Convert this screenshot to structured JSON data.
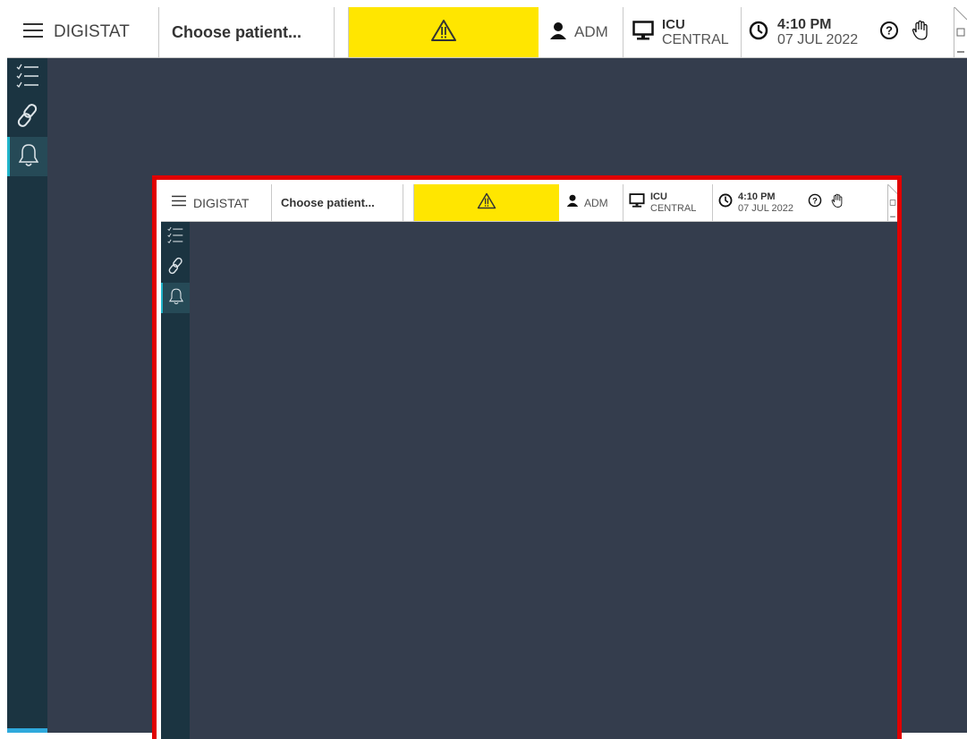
{
  "topbar": {
    "app_name": "DIGISTAT",
    "patient": "Choose patient...",
    "user": "ADM",
    "workstation": {
      "line1": "ICU",
      "line2": "CENTRAL"
    },
    "clock": {
      "time": "4:10 PM",
      "date": "07 JUL 2022"
    },
    "alarm_color": "#ffe600"
  },
  "sidebar": {
    "items": [
      {
        "icon": "checklist-icon",
        "active": false
      },
      {
        "icon": "link-icon",
        "active": false
      },
      {
        "icon": "bell-icon",
        "active": true
      }
    ]
  },
  "icons": [
    "menu-icon",
    "warning-icon",
    "user-icon",
    "monitor-icon",
    "clock-icon",
    "help-icon",
    "hand-icon"
  ],
  "colors": {
    "workspace": "#343d4d",
    "sidebar": "#1b3441",
    "accent": "#1fb3c9",
    "highlight_frame": "#e00000"
  }
}
